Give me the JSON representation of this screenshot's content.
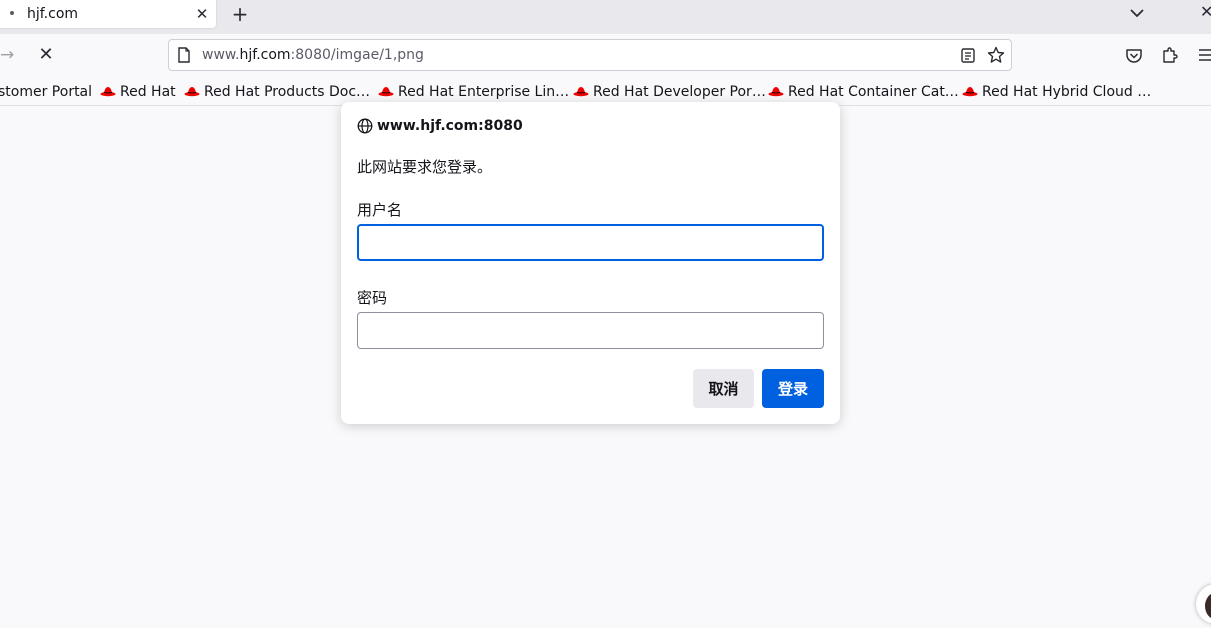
{
  "tab": {
    "title": "hjf.com",
    "close_glyph": "✕",
    "new_tab_glyph": "+"
  },
  "nav": {
    "forward_glyph": "→",
    "stop_glyph": "✕",
    "url_prefix": "www.",
    "url_host": "hjf.com",
    "url_rest": ":8080/imgae/1,png"
  },
  "bookmarks": [
    {
      "label": "stomer Portal",
      "icon": "none"
    },
    {
      "label": "Red Hat",
      "icon": "redhat-icon"
    },
    {
      "label": "Red Hat Products Doc…",
      "icon": "redhat-icon"
    },
    {
      "label": "Red Hat Enterprise Lin…",
      "icon": "redhat-icon"
    },
    {
      "label": "Red Hat Developer Por…",
      "icon": "redhat-icon"
    },
    {
      "label": "Red Hat Container Cat…",
      "icon": "redhat-icon"
    },
    {
      "label": "Red Hat Hybrid Cloud …",
      "icon": "redhat-icon"
    }
  ],
  "dialog": {
    "host": "www.hjf.com:8080",
    "message": "此网站要求您登录。",
    "username_label": "用户名",
    "username_value": "",
    "password_label": "密码",
    "password_value": "",
    "cancel_label": "取消",
    "login_label": "登录"
  },
  "colors": {
    "accent": "#0061e0",
    "redhat": "#ee0000",
    "background": "#f9f9fb"
  }
}
